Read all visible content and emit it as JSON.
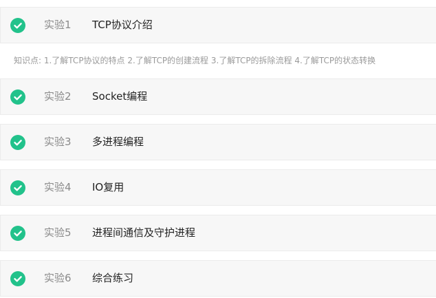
{
  "labs": [
    {
      "num": "实验1",
      "title": "TCP协议介绍",
      "icon": "check-circle-icon",
      "status": "completed"
    },
    {
      "num": "实验2",
      "title": "Socket编程",
      "icon": "check-circle-icon",
      "status": "completed"
    },
    {
      "num": "实验3",
      "title": "多进程编程",
      "icon": "check-circle-icon",
      "status": "completed"
    },
    {
      "num": "实验4",
      "title": "IO复用",
      "icon": "check-circle-icon",
      "status": "completed"
    },
    {
      "num": "实验5",
      "title": "进程间通信及守护进程",
      "icon": "check-circle-icon",
      "status": "completed"
    },
    {
      "num": "实验6",
      "title": "综合练习",
      "icon": "check-circle-icon",
      "status": "completed"
    }
  ],
  "lab1_knowledge": "知识点: 1.了解TCP协议的特点 2.了解TCP的创建流程 3.了解TCP的拆除流程 4.了解TCP的状态转换",
  "colors": {
    "check": "#22c28b",
    "row_bg": "#f7f7f7",
    "row_border": "#ebebeb",
    "num_text": "#8a8a8a",
    "title_text": "#222222",
    "desc_text": "#9a9a9a"
  }
}
